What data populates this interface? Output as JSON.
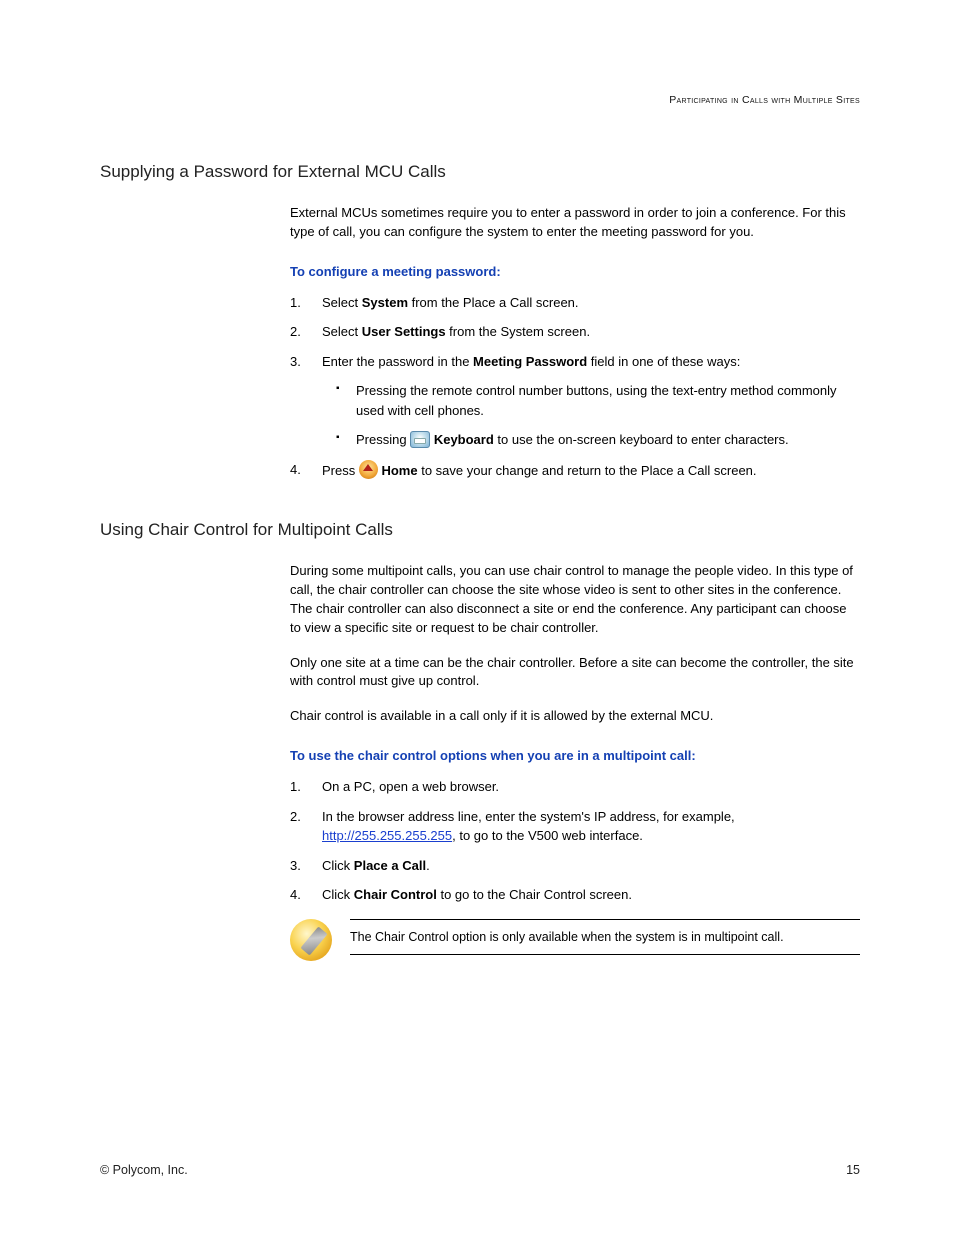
{
  "header": "Participating in Calls with Multiple Sites",
  "s1": {
    "title": "Supplying a Password for External MCU Calls",
    "intro": "External MCUs sometimes require you to enter a password in order to join a conference. For this type of call, you can configure the system to enter the meeting password for you.",
    "proc": "To configure a meeting password:",
    "li1a": "Select ",
    "li1b": "System",
    "li1c": " from the Place a Call screen.",
    "li2a": "Select ",
    "li2b": "User Settings",
    "li2c": " from the System screen.",
    "li3a": "Enter the password in the ",
    "li3b": "Meeting Password",
    "li3c": " field in one of these ways:",
    "sub1": "Pressing the remote control number buttons, using the text-entry method commonly used with cell phones.",
    "sub2a": "Pressing ",
    "sub2b": "Keyboard",
    "sub2c": " to use the on-screen keyboard to enter characters.",
    "li4a": "Press ",
    "li4b": "Home",
    "li4c": " to save your change and return to the Place a Call screen."
  },
  "s2": {
    "title": "Using Chair Control for Multipoint Calls",
    "p1": "During some multipoint calls, you can use chair control to manage the people video. In this type of call, the chair controller can choose the site whose video is sent to other sites in the conference. The chair controller can also disconnect a site or end the conference. Any participant can choose to view a specific site or request to be chair controller.",
    "p2": "Only one site at a time can be the chair controller. Before a site can become the controller, the site with control must give up control.",
    "p3": "Chair control is available in a call only if it is allowed by the external MCU.",
    "proc": "To use the chair control options when you are in a multipoint call:",
    "li1": "On a PC, open a web browser.",
    "li2a": "In the browser address line, enter the system's IP address, for example, ",
    "li2link": "http://255.255.255.255",
    "li2b": ", to go to the V500 web interface.",
    "li3a": "Click ",
    "li3b": "Place a Call",
    "li3c": ".",
    "li4a": "Click ",
    "li4b": "Chair Control",
    "li4c": " to go to the Chair Control screen.",
    "note": "The Chair Control option is only available when the system is in multipoint call."
  },
  "footer": {
    "left": "© Polycom, Inc.",
    "right": "15"
  }
}
